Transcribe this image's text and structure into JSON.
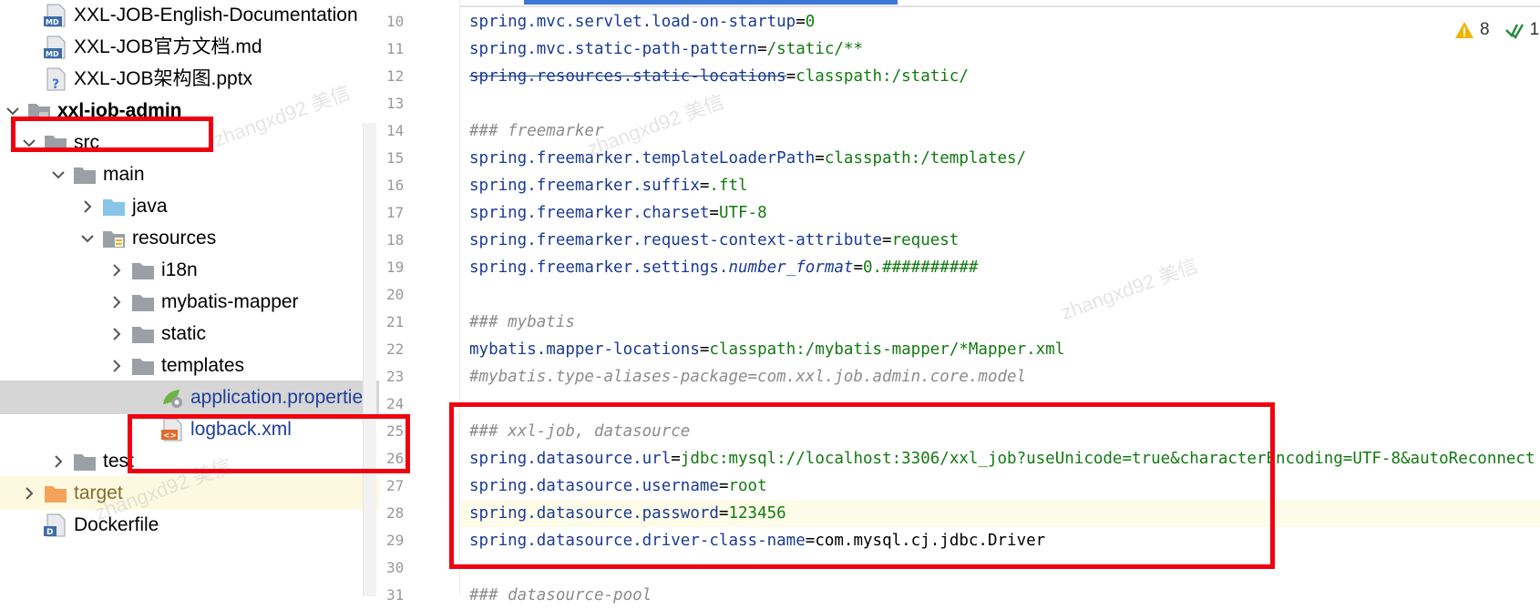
{
  "tree": {
    "items": [
      {
        "label": "XXL-JOB-English-Documentation",
        "icon": "markdown-file-icon",
        "depth": 0,
        "arrow": "none",
        "style": "normal"
      },
      {
        "label": "XXL-JOB官方文档.md",
        "icon": "markdown-file-icon",
        "depth": 0,
        "arrow": "none",
        "style": "normal"
      },
      {
        "label": "XXL-JOB架构图.pptx",
        "icon": "unknown-file-icon",
        "depth": 0,
        "arrow": "none",
        "style": "normal"
      },
      {
        "label": "xxl-job-admin",
        "icon": "module-folder-icon",
        "depth": -1,
        "arrow": "down",
        "style": "bold"
      },
      {
        "label": "src",
        "icon": "folder-icon",
        "depth": 0,
        "arrow": "down",
        "style": "normal"
      },
      {
        "label": "main",
        "icon": "folder-icon",
        "depth": 1,
        "arrow": "down",
        "style": "normal"
      },
      {
        "label": "java",
        "icon": "source-folder-icon",
        "depth": 2,
        "arrow": "right",
        "style": "normal"
      },
      {
        "label": "resources",
        "icon": "resources-folder-icon",
        "depth": 2,
        "arrow": "down",
        "style": "normal"
      },
      {
        "label": "i18n",
        "icon": "folder-icon",
        "depth": 3,
        "arrow": "right",
        "style": "normal"
      },
      {
        "label": "mybatis-mapper",
        "icon": "folder-icon",
        "depth": 3,
        "arrow": "right",
        "style": "normal"
      },
      {
        "label": "static",
        "icon": "folder-icon",
        "depth": 3,
        "arrow": "right",
        "style": "normal"
      },
      {
        "label": "templates",
        "icon": "folder-icon",
        "depth": 3,
        "arrow": "right",
        "style": "normal"
      },
      {
        "label": "application.properties",
        "icon": "properties-file-icon",
        "depth": 4,
        "arrow": "none",
        "style": "selected"
      },
      {
        "label": "logback.xml",
        "icon": "xml-file-icon",
        "depth": 4,
        "arrow": "none",
        "style": "blue"
      },
      {
        "label": "test",
        "icon": "folder-icon",
        "depth": 1,
        "arrow": "right",
        "style": "normal"
      },
      {
        "label": "target",
        "icon": "excluded-folder-icon",
        "depth": 0,
        "arrow": "right",
        "style": "target"
      },
      {
        "label": "Dockerfile",
        "icon": "docker-file-icon",
        "depth": 0,
        "arrow": "none",
        "style": "normal"
      }
    ]
  },
  "inspection": {
    "warnings": "8",
    "checks": "1"
  },
  "colors": {
    "highlight_red": "#f00010",
    "accent": "#3b78d8"
  },
  "editor": {
    "lines": [
      {
        "n": "10",
        "key": "spring.mvc.servlet.load-on-startup",
        "eq": "=",
        "val": "0"
      },
      {
        "n": "11",
        "key": "spring.mvc.static-path-pattern",
        "eq": "=",
        "val": "/static/**"
      },
      {
        "n": "12",
        "key": "spring.resources.static-locations",
        "eq": "=",
        "val": "classpath:/static/",
        "strike": true
      },
      {
        "n": "13"
      },
      {
        "n": "14",
        "comment": "### freemarker"
      },
      {
        "n": "15",
        "key": "spring.freemarker.templateLoaderPath",
        "eq": "=",
        "val": "classpath:/templates/"
      },
      {
        "n": "16",
        "key": "spring.freemarker.suffix",
        "eq": "=",
        "val": ".ftl"
      },
      {
        "n": "17",
        "key": "spring.freemarker.charset",
        "eq": "=",
        "val": "UTF-8"
      },
      {
        "n": "18",
        "key": "spring.freemarker.request-context-attribute",
        "eq": "=",
        "val": "request"
      },
      {
        "n": "19",
        "key": "spring.freemarker.settings.",
        "key2": "number_format",
        "eq": "=",
        "val": "0.##########"
      },
      {
        "n": "20"
      },
      {
        "n": "21",
        "comment": "### mybatis"
      },
      {
        "n": "22",
        "key": "mybatis.mapper-locations",
        "eq": "=",
        "val": "classpath:/mybatis-mapper/*Mapper.xml"
      },
      {
        "n": "23",
        "comment": "#mybatis.type-aliases-package=com.xxl.job.admin.core.model"
      },
      {
        "n": "24"
      },
      {
        "n": "25",
        "comment": "### xxl-job, datasource"
      },
      {
        "n": "26",
        "key": "spring.datasource.url",
        "eq": "=",
        "val": "jdbc:mysql://localhost:3306/xxl_job?useUnicode=true&characterEncoding=UTF-8&autoReconnect"
      },
      {
        "n": "27",
        "key": "spring.datasource.username",
        "eq": "=",
        "val": "root"
      },
      {
        "n": "28",
        "key": "spring.datasource.password",
        "eq": "=",
        "val": "123456",
        "hl": true
      },
      {
        "n": "29",
        "key": "spring.datasource.driver-class-name",
        "eq": "=",
        "plain": "com.mysql.cj.jdbc.Driver"
      },
      {
        "n": "30"
      },
      {
        "n": "31",
        "comment": "### datasource-pool"
      }
    ]
  }
}
